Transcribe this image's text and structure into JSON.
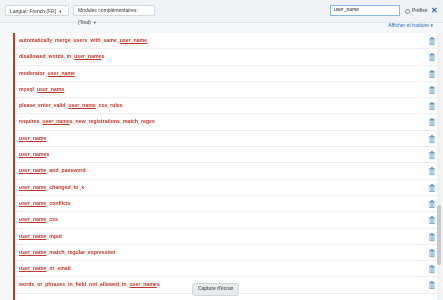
{
  "toolbar": {
    "language_label": "Langue: French (FR)",
    "module_label": "Modules complémentaires: (Tout)",
    "search_value": "user_name",
    "prefix_label": "Préfixe",
    "close_label": "✕"
  },
  "subbar": {
    "toggle_label": "Afficher et traduire ▾"
  },
  "rows": [
    {
      "pre": "automatically_merge_users_with_same_",
      "hl": "user_name",
      "post": ""
    },
    {
      "pre": "disallowed_words_in_",
      "hl": "user_name",
      "post": "s"
    },
    {
      "pre": "moderator_",
      "hl": "user_name",
      "post": ""
    },
    {
      "pre": "mysql_",
      "hl": "user_name",
      "post": ""
    },
    {
      "pre": "please_enter_valid_",
      "hl": "user_name",
      "post": "_css_rules"
    },
    {
      "pre": "requires_",
      "hl": "user_name",
      "post": "s_new_registrations_match_regex"
    },
    {
      "pre": "",
      "hl": "user_name",
      "post": ""
    },
    {
      "pre": "",
      "hl": "user_name",
      "post": "s"
    },
    {
      "pre": "",
      "hl": "user_name",
      "post": "_and_password"
    },
    {
      "pre": "",
      "hl": "user_name",
      "post": "_changed_to_x"
    },
    {
      "pre": "",
      "hl": "user_name",
      "post": "_conflicts"
    },
    {
      "pre": "",
      "hl": "user_name",
      "post": "_css"
    },
    {
      "pre": "",
      "hl": "user_name",
      "post": "_input"
    },
    {
      "pre": "",
      "hl": "user_name",
      "post": "_match_regular_expression"
    },
    {
      "pre": "",
      "hl": "user_name",
      "post": "_or_email"
    },
    {
      "pre": "words_or_phrases_in_field_not_allowed_in_",
      "hl": "user_name",
      "post": "s"
    }
  ],
  "tooltip": "Capture d'écran",
  "colors": {
    "accent": "#c0392b",
    "link": "#2a6fb0"
  }
}
